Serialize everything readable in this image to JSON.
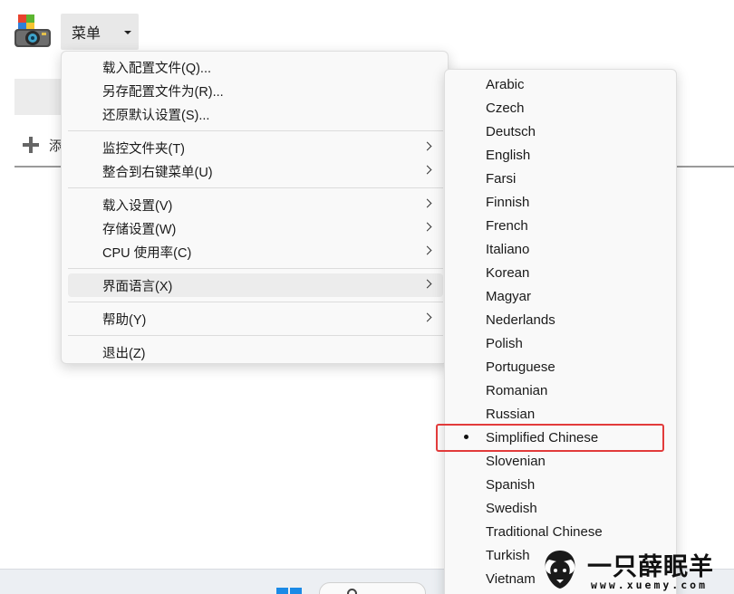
{
  "app": {
    "menu_label": "菜单",
    "add_label": "添"
  },
  "context_menu": {
    "groups": [
      {
        "items": [
          {
            "label": "载入配置文件(Q)...",
            "has_submenu": false
          },
          {
            "label": "另存配置文件为(R)...",
            "has_submenu": false
          },
          {
            "label": "还原默认设置(S)...",
            "has_submenu": false
          }
        ]
      },
      {
        "items": [
          {
            "label": "监控文件夹(T)",
            "has_submenu": true
          },
          {
            "label": "整合到右键菜单(U)",
            "has_submenu": true
          }
        ]
      },
      {
        "items": [
          {
            "label": "载入设置(V)",
            "has_submenu": true
          },
          {
            "label": "存储设置(W)",
            "has_submenu": true
          },
          {
            "label": "CPU 使用率(C)",
            "has_submenu": true
          }
        ]
      },
      {
        "items": [
          {
            "label": "界面语言(X)",
            "has_submenu": true,
            "highlighted": true
          }
        ]
      },
      {
        "items": [
          {
            "label": "帮助(Y)",
            "has_submenu": true
          }
        ]
      },
      {
        "items": [
          {
            "label": "退出(Z)",
            "has_submenu": false
          }
        ]
      }
    ]
  },
  "language_menu": {
    "selected": "Simplified Chinese",
    "highlight_color": "#e23b3b",
    "items": [
      "Arabic",
      "Czech",
      "Deutsch",
      "English",
      "Farsi",
      "Finnish",
      "French",
      "Italiano",
      "Korean",
      "Magyar",
      "Nederlands",
      "Polish",
      "Portuguese",
      "Romanian",
      "Russian",
      "Simplified Chinese",
      "Slovenian",
      "Spanish",
      "Swedish",
      "Traditional Chinese",
      "Turkish",
      "Vietnam"
    ]
  },
  "watermark": {
    "title": "一只薛眠羊",
    "url": "www.xuemy.com"
  }
}
